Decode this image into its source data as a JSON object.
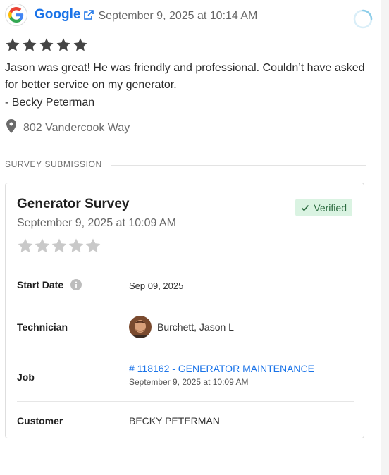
{
  "review": {
    "source": "Google",
    "date": "September 9, 2025 at 10:14 AM",
    "rating": 5,
    "text": "Jason was great! He was friendly and professional. Couldn’t have asked for better service on my generator.",
    "author": "- Becky Peterman",
    "location": "802 Vandercook Way"
  },
  "section_label": "SURVEY SUBMISSION",
  "survey": {
    "title": "Generator Survey",
    "date": "September 9, 2025 at 10:09 AM",
    "badge": "Verified",
    "rating": 0,
    "fields": {
      "start_date_label": "Start Date",
      "start_date_value": "Sep 09, 2025",
      "technician_label": "Technician",
      "technician_value": "Burchett, Jason L",
      "job_label": "Job",
      "job_link": "# 118162 - GENERATOR MAINTENANCE",
      "job_date": "September 9, 2025 at 10:09 AM",
      "customer_label": "Customer",
      "customer_value": "BECKY PETERMAN"
    }
  },
  "colors": {
    "link": "#1a73e8",
    "star_filled": "#444444",
    "star_empty": "#c9c9c9",
    "verified_bg": "#daf3e2",
    "verified_text": "#2b6b3f"
  }
}
